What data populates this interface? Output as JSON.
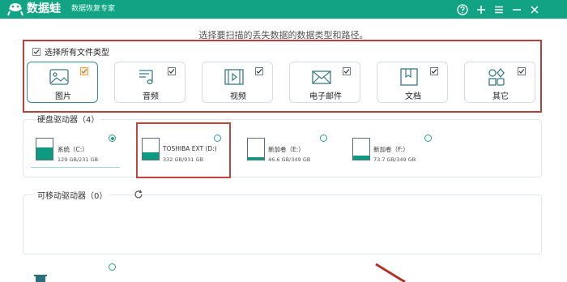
{
  "app": {
    "name": "数据蛙",
    "subtitle": "数据恢复专家"
  },
  "titlebar_controls": [
    "help-icon",
    "plus-icon",
    "menu-icon",
    "minimize-icon",
    "close-icon"
  ],
  "instruction": "选择要扫描的丢失数据的数据类型和路径。",
  "types": {
    "select_all_label": "选择所有文件类型",
    "items": [
      {
        "label": "图片",
        "icon": "picture-icon",
        "checked": true
      },
      {
        "label": "音频",
        "icon": "music-icon",
        "checked": true
      },
      {
        "label": "视频",
        "icon": "video-icon",
        "checked": true
      },
      {
        "label": "电子邮件",
        "icon": "email-icon",
        "checked": true
      },
      {
        "label": "文档",
        "icon": "document-icon",
        "checked": true
      },
      {
        "label": "其它",
        "icon": "other-icon",
        "checked": true
      }
    ]
  },
  "drives": {
    "section_label": "硬盘驱动器（4）",
    "items": [
      {
        "name": "系统（C:）",
        "size": "129 GB/231 GB",
        "used_fraction": 0.56,
        "selected": true
      },
      {
        "name": "TOSHIBA EXT (D:)",
        "size": "332 GB/931 GB",
        "used_fraction": 0.36,
        "selected": false
      },
      {
        "name": "新加卷（E:）",
        "size": "46.6 GB/349 GB",
        "used_fraction": 0.13,
        "selected": false
      },
      {
        "name": "新加卷（F:）",
        "size": "73.7 GB/349 GB",
        "used_fraction": 0.21,
        "selected": false
      }
    ]
  },
  "removable": {
    "section_label": "可移动驱动器（0）"
  },
  "colors": {
    "brand": "#12a384",
    "highlight": "#c4443d",
    "disk_fill": "#0e9a80"
  }
}
